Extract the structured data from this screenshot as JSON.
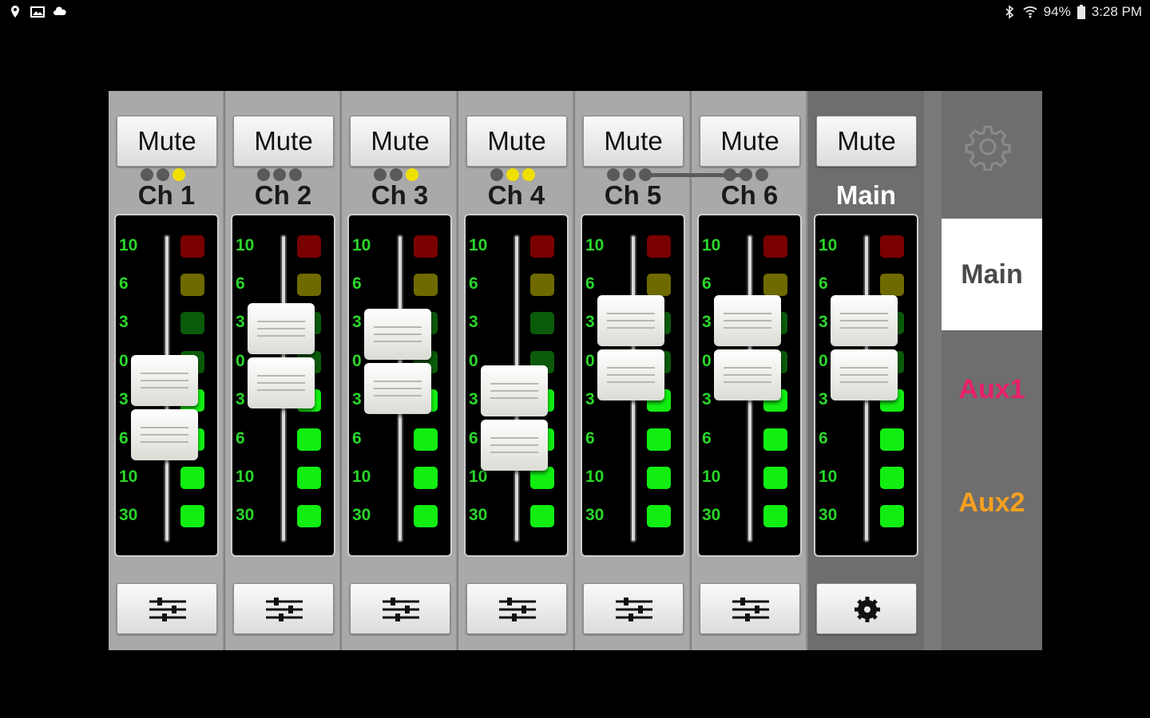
{
  "status_bar": {
    "battery": "94%",
    "time": "3:28 PM",
    "left_icons": [
      "location-icon",
      "image-icon",
      "cloud-icon"
    ],
    "right_icons": [
      "bluetooth-icon",
      "wifi-icon",
      "battery-icon"
    ]
  },
  "channels": [
    {
      "label": "Ch 1",
      "mute": "Mute",
      "dots": [
        false,
        false,
        true
      ],
      "fader_level": 0.4,
      "ticks": [
        "10",
        "6",
        "3",
        "0",
        "3",
        "6",
        "10",
        "30"
      ]
    },
    {
      "label": "Ch 2",
      "mute": "Mute",
      "dots": [
        false,
        false,
        false
      ],
      "fader_level": 0.66,
      "ticks": [
        "10",
        "6",
        "3",
        "0",
        "3",
        "6",
        "10",
        "30"
      ]
    },
    {
      "label": "Ch 3",
      "mute": "Mute",
      "dots": [
        false,
        false,
        true
      ],
      "fader_level": 0.63,
      "ticks": [
        "10",
        "6",
        "3",
        "0",
        "3",
        "6",
        "10",
        "30"
      ]
    },
    {
      "label": "Ch 4",
      "mute": "Mute",
      "dots": [
        false,
        true,
        true
      ],
      "fader_level": 0.35,
      "ticks": [
        "10",
        "6",
        "3",
        "0",
        "3",
        "6",
        "10",
        "30"
      ]
    },
    {
      "label": "Ch 5",
      "mute": "Mute",
      "dots": [
        false,
        false,
        false
      ],
      "fader_level": 0.7,
      "ticks": [
        "10",
        "6",
        "3",
        "0",
        "3",
        "6",
        "10",
        "30"
      ]
    },
    {
      "label": "Ch 6",
      "mute": "Mute",
      "dots": [
        false,
        false,
        false
      ],
      "fader_level": 0.7,
      "ticks": [
        "10",
        "6",
        "3",
        "0",
        "3",
        "6",
        "10",
        "30"
      ]
    }
  ],
  "main": {
    "label": "Main",
    "mute": "Mute",
    "fader_level": 0.7,
    "ticks": [
      "10",
      "6",
      "3",
      "0",
      "3",
      "6",
      "10",
      "30"
    ]
  },
  "sidebar": {
    "mixes": [
      {
        "label": "Main",
        "color": "#4a4a4a",
        "selected": true
      },
      {
        "label": "Aux1",
        "color": "#e8206a",
        "selected": false
      },
      {
        "label": "Aux2",
        "color": "#f5a020",
        "selected": false
      }
    ]
  },
  "colors": {
    "led_red": "#7a0000",
    "led_yellow": "#6e6a00",
    "led_green_dim": "#0b5a0b",
    "led_green": "#12ee12"
  }
}
